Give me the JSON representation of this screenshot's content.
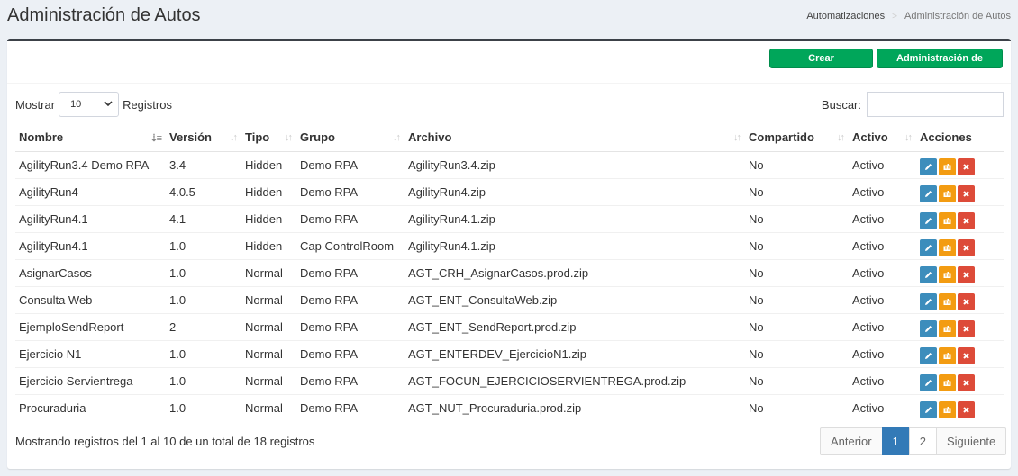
{
  "header": {
    "title": "Administración de Autos",
    "breadcrumb": {
      "link": "Automatizaciones",
      "separator": ">",
      "active": "Administración de Autos"
    }
  },
  "toolbar": {
    "crear_label": "Crear Automatización",
    "archivos_label": "Administración de Archivos"
  },
  "length_control": {
    "prefix": "Mostrar",
    "value": "10",
    "suffix": "Registros"
  },
  "search": {
    "label": "Buscar:",
    "value": ""
  },
  "table": {
    "columns": [
      "Nombre",
      "Versión",
      "Tipo",
      "Grupo",
      "Archivo",
      "Compartido",
      "Activo",
      "Acciones"
    ],
    "rows": [
      [
        "AgilityRun3.4 Demo RPA",
        "3.4",
        "Hidden",
        "Demo RPA",
        "AgilityRun3.4.zip",
        "No",
        "Activo"
      ],
      [
        "AgilityRun4",
        "4.0.5",
        "Hidden",
        "Demo RPA",
        "AgilityRun4.zip",
        "No",
        "Activo"
      ],
      [
        "AgilityRun4.1",
        "4.1",
        "Hidden",
        "Demo RPA",
        "AgilityRun4.1.zip",
        "No",
        "Activo"
      ],
      [
        "AgilityRun4.1",
        "1.0",
        "Hidden",
        "Cap ControlRoom",
        "AgilityRun4.1.zip",
        "No",
        "Activo"
      ],
      [
        "AsignarCasos",
        "1.0",
        "Normal",
        "Demo RPA",
        "AGT_CRH_AsignarCasos.prod.zip",
        "No",
        "Activo"
      ],
      [
        "Consulta Web",
        "1.0",
        "Normal",
        "Demo RPA",
        "AGT_ENT_ConsultaWeb.zip",
        "No",
        "Activo"
      ],
      [
        "EjemploSendReport",
        "2",
        "Normal",
        "Demo RPA",
        "AGT_ENT_SendReport.prod.zip",
        "No",
        "Activo"
      ],
      [
        "Ejercicio N1",
        "1.0",
        "Normal",
        "Demo RPA",
        "AGT_ENTERDEV_EjercicioN1.zip",
        "No",
        "Activo"
      ],
      [
        "Ejercicio Servientrega",
        "1.0",
        "Normal",
        "Demo RPA",
        "AGT_FOCUN_EJERCICIOSERVIENTREGA.prod.zip",
        "No",
        "Activo"
      ],
      [
        "Procuraduria",
        "1.0",
        "Normal",
        "Demo RPA",
        "AGT_NUT_Procuraduria.prod.zip",
        "No",
        "Activo"
      ]
    ],
    "action_icons": [
      "pencil-icon",
      "package-icon",
      "close-icon"
    ]
  },
  "footer": {
    "info": "Mostrando registros del 1 al 10 de un total de 18 registros",
    "pagination": {
      "prev": "Anterior",
      "pages": [
        "1",
        "2"
      ],
      "current": "1",
      "next": "Siguiente"
    }
  },
  "colors": {
    "green": "#00a65a",
    "edit": "#3c8dbc",
    "package": "#f39c12",
    "delete": "#dd4b39",
    "page_active": "#337ab7"
  }
}
